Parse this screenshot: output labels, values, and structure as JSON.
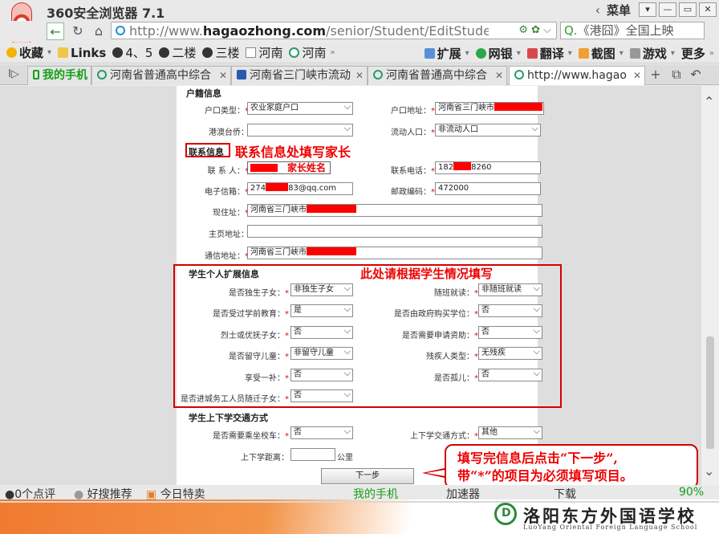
{
  "browser": {
    "title": "360安全浏览器 7.1",
    "menu_label": "菜单",
    "url_prefix": "http://www.",
    "url_domain": "hagaozhong.com",
    "url_path": "/senior/Student/EditStudentIr",
    "search_text": "《港囧》全国上映"
  },
  "bookmarks": [
    {
      "label": "收藏"
    },
    {
      "label": "Links"
    },
    {
      "label": "4、5"
    },
    {
      "label": "二楼"
    },
    {
      "label": "三楼"
    },
    {
      "label": "河南"
    },
    {
      "label": "河南"
    }
  ],
  "bookmarks_right": [
    {
      "label": "扩展"
    },
    {
      "label": "网银"
    },
    {
      "label": "翻译"
    },
    {
      "label": "截图"
    },
    {
      "label": "游戏"
    },
    {
      "label": "更多"
    }
  ],
  "tabs": [
    {
      "label": "我的手机"
    },
    {
      "label": "河南省普通高中综合"
    },
    {
      "label": "河南省三门峡市流动"
    },
    {
      "label": "河南省普通高中综合"
    },
    {
      "label": "http://www.hagao"
    }
  ],
  "form": {
    "huji": {
      "section": "户籍信息",
      "hukou_type_label": "户口类型：",
      "hukou_type_value": "农业家庭户口",
      "hukou_addr_label": "户口地址：",
      "hukou_addr_value": "河南省三门峡市",
      "gangao_label": "港澳台侨：",
      "gangao_value": "",
      "liudong_label": "流动人口：",
      "liudong_value": "非流动人口"
    },
    "contact": {
      "section": "联系信息",
      "contact_name_label": "联 系 人：",
      "contact_name_hint": "家长姓名",
      "phone_label": "联系电话：",
      "phone_a": "182",
      "phone_b": "8260",
      "email_label": "电子信箱：",
      "email_a": "274",
      "email_b": "83@qq.com",
      "postcode_label": "邮政编码：",
      "postcode_value": "472000",
      "current_addr_label": "现住址：",
      "current_addr_value": "河南省三门峡市",
      "homepage_label": "主页地址：",
      "mail_addr_label": "通信地址：",
      "mail_addr_value": "河南省三门峡市"
    },
    "ext": {
      "section": "学生个人扩展信息",
      "fields": [
        {
          "label": "是否独生子女：",
          "value": "非独生子女"
        },
        {
          "label": "随班就读：",
          "value": "非随班就读"
        },
        {
          "label": "是否受过学前教育：",
          "value": "是"
        },
        {
          "label": "是否由政府购买学位：",
          "value": "否"
        },
        {
          "label": "烈士或优抚子女：",
          "value": "否"
        },
        {
          "label": "是否需要申请资助：",
          "value": "否"
        },
        {
          "label": "是否留守儿童：",
          "value": "非留守儿童"
        },
        {
          "label": "残疾人类型：",
          "value": "无残疾"
        },
        {
          "label": "享受一补：",
          "value": "否"
        },
        {
          "label": "是否孤儿：",
          "value": "否"
        },
        {
          "label": "是否进城务工人员随迁子女：",
          "value": "否"
        }
      ]
    },
    "transport": {
      "section": "学生上下学交通方式",
      "bus_label": "是否需要乘坐校车：",
      "bus_value": "否",
      "mode_label": "上下学交通方式：",
      "mode_value": "其他",
      "distance_label": "上下学距离：",
      "distance_unit": "公里"
    },
    "next_button": "下一步"
  },
  "annotations": {
    "contact_note": "联系信息处填写家长",
    "ext_note": "此处请根据学生情况填写",
    "callout_line1": "填写完信息后点击“下一步”,",
    "callout_line2": "带“*”的项目为必须填写项目。"
  },
  "status_bar": {
    "item1": "0个点评",
    "item2": "好搜推荐",
    "item3": "今日特卖",
    "item4": "我的手机",
    "item5": "加速器",
    "item6": "下载",
    "zoom": "90%"
  },
  "footer": {
    "school_cn": "洛阳东方外国语学校",
    "school_en": "LuoYang Oriental Foreign Language School"
  },
  "colors": {
    "annotation_red": "#e00000",
    "required_star": "#e00000",
    "tab_green": "#14a014"
  }
}
